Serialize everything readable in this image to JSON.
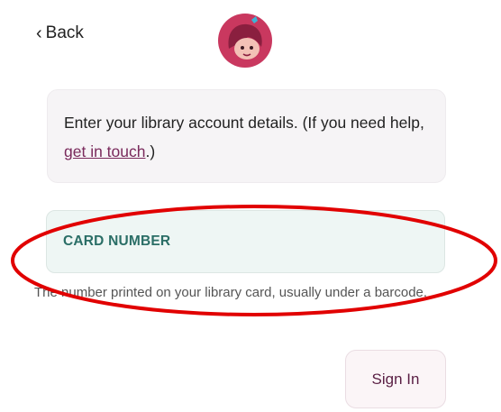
{
  "header": {
    "back_label": "Back",
    "back_icon": "chevron-left-icon",
    "logo_icon": "libby-logo-icon"
  },
  "info": {
    "text_before": "Enter your library account details. (If you need help, ",
    "link_text": "get in touch",
    "text_after": ".)"
  },
  "card_field": {
    "label": "CARD NUMBER",
    "helper": "The number printed on your library card, usually under a barcode."
  },
  "sign_in_label": "Sign In",
  "colors": {
    "link": "#7a2a5c",
    "field_label": "#2a6e66",
    "annotation": "#e10000",
    "logo_bg": "#c9385f"
  }
}
